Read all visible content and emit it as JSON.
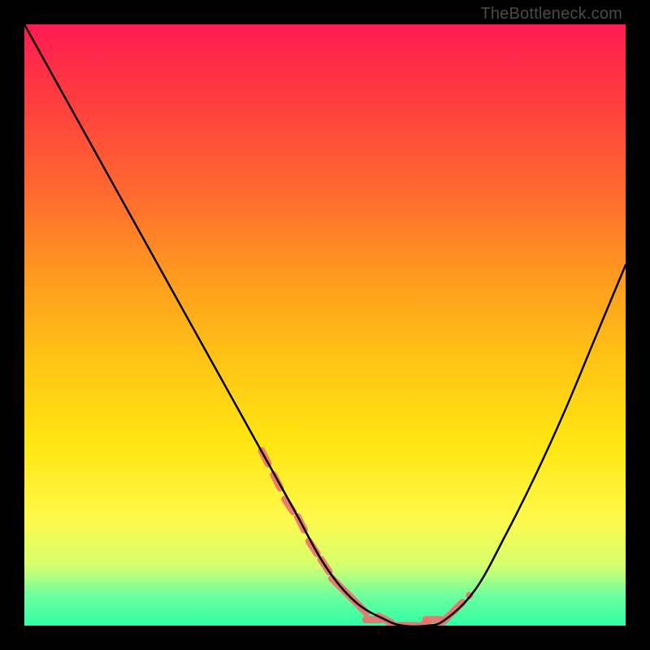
{
  "watermark": "TheBottleneck.com",
  "chart_data": {
    "type": "line",
    "title": "",
    "xlabel": "",
    "ylabel": "",
    "xlim": [
      0,
      100
    ],
    "ylim": [
      0,
      100
    ],
    "grid": false,
    "legend": false,
    "background_gradient": {
      "direction": "vertical",
      "stops": [
        {
          "pos": 0.0,
          "color": "#ff1a52"
        },
        {
          "pos": 0.12,
          "color": "#ff3b3f"
        },
        {
          "pos": 0.28,
          "color": "#ff6a2f"
        },
        {
          "pos": 0.42,
          "color": "#ff9a1f"
        },
        {
          "pos": 0.55,
          "color": "#ffc215"
        },
        {
          "pos": 0.7,
          "color": "#ffe612"
        },
        {
          "pos": 0.82,
          "color": "#fff94a"
        },
        {
          "pos": 0.9,
          "color": "#d6ff6d"
        },
        {
          "pos": 0.95,
          "color": "#6dff9e"
        },
        {
          "pos": 1.0,
          "color": "#2effa4"
        }
      ]
    },
    "series": [
      {
        "name": "bottleneck-curve",
        "color": "#000000",
        "x": [
          0,
          5,
          10,
          15,
          20,
          25,
          30,
          35,
          40,
          45,
          50,
          55,
          60,
          63,
          67,
          70,
          75,
          80,
          85,
          90,
          95,
          100
        ],
        "y": [
          100,
          91,
          82,
          73,
          64,
          55,
          46,
          37,
          28,
          19,
          10,
          4,
          1,
          0,
          0,
          1,
          6,
          15,
          25,
          36,
          48,
          60
        ]
      }
    ],
    "markers": [
      {
        "name": "highlight-dots",
        "color": "#ef6f6f",
        "x": [
          40,
          42,
          44,
          46,
          48,
          50,
          52,
          54,
          56,
          58,
          60,
          62,
          64,
          66,
          68,
          70,
          72,
          74
        ],
        "y": [
          28,
          24,
          20,
          17,
          13,
          10,
          7,
          5,
          3,
          1,
          1,
          0,
          0,
          0,
          1,
          1,
          3,
          5
        ]
      }
    ]
  }
}
